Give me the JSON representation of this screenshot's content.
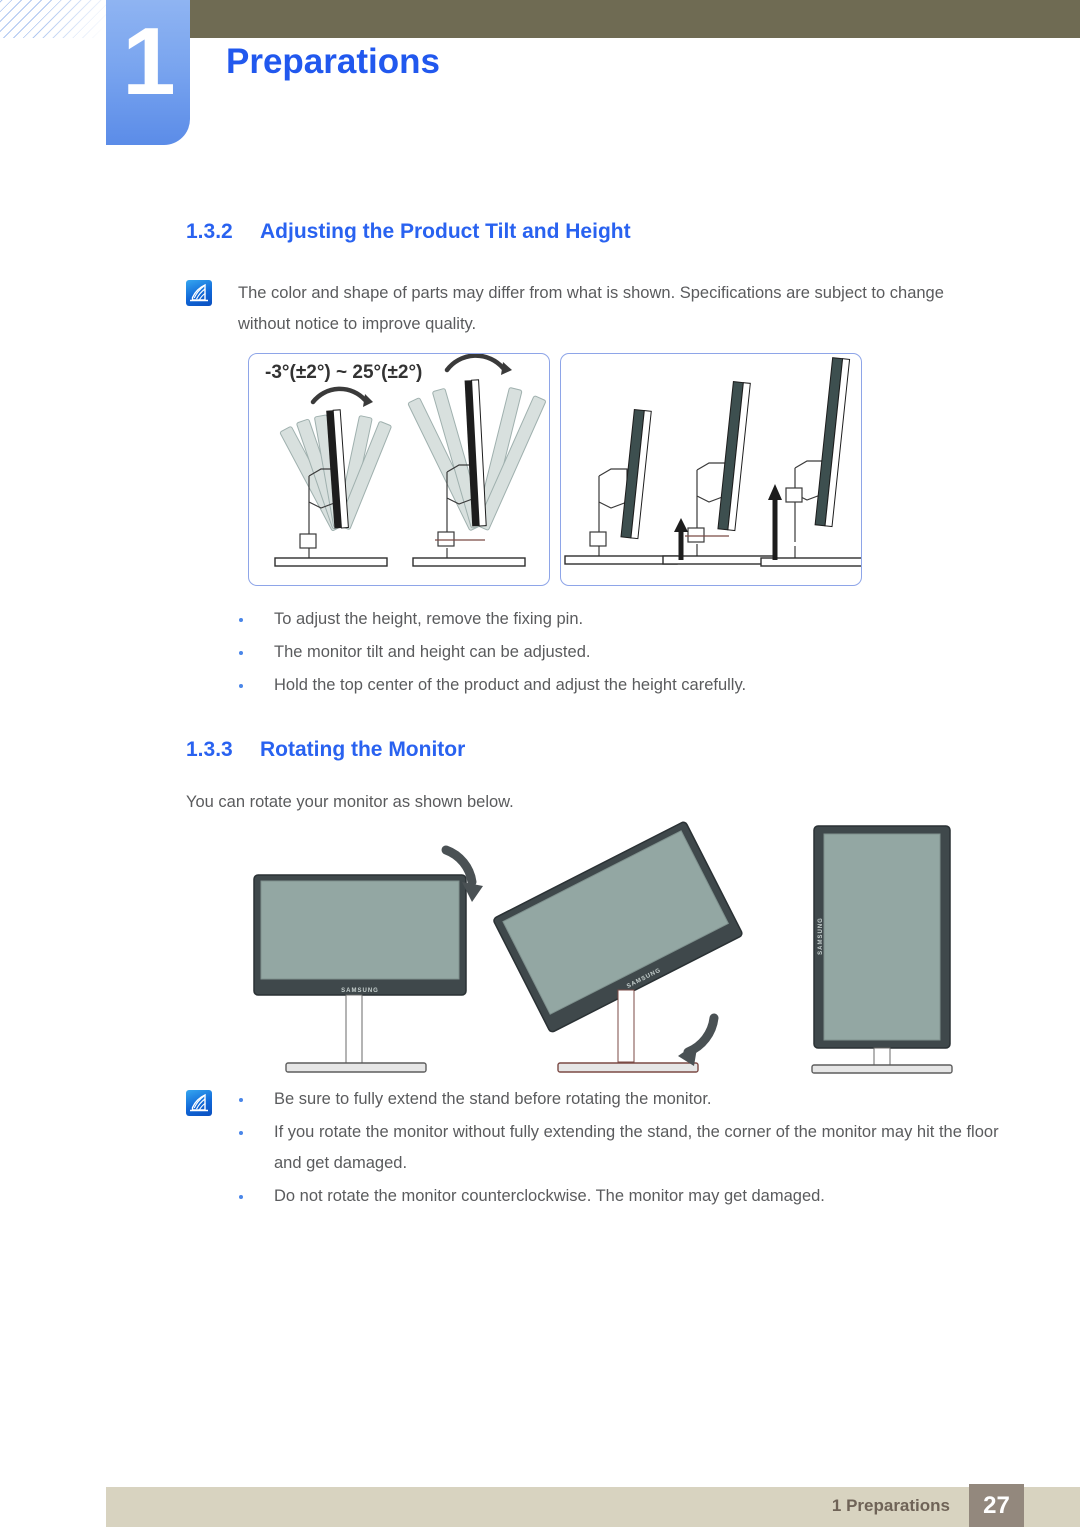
{
  "header": {
    "chapter_number": "1",
    "chapter_title": "Preparations"
  },
  "sections": [
    {
      "number": "1.3.2",
      "title": "Adjusting the Product Tilt and Height",
      "note": "The color and shape of parts may differ from what is shown. Specifications are subject to change without notice to improve quality.",
      "note_icon": "note-pen-icon",
      "tilt_range_label": "-3°(±2°) ~ 25°(±2°)",
      "bullets": [
        "To adjust the height, remove the fixing pin.",
        "The monitor tilt and height can be adjusted.",
        "Hold the top center of the product and adjust the height carefully."
      ]
    },
    {
      "number": "1.3.3",
      "title": "Rotating the Monitor",
      "intro": "You can rotate your monitor as shown below.",
      "note_icon": "note-pen-icon",
      "bullets": [
        "Be sure to fully extend the stand before rotating the monitor.",
        "If you rotate the monitor without fully extending the stand, the corner of the monitor may hit the floor and get damaged.",
        "Do not rotate the monitor counterclockwise. The monitor may get damaged."
      ]
    }
  ],
  "illustrations": {
    "tilt_box_caption": "monitor tilt range side views",
    "height_box_caption": "monitor height adjustment side views",
    "rotate_caption": "monitor rotation landscape to portrait",
    "brand_logo": "SAMSUNG"
  },
  "footer": {
    "label": "1 Preparations",
    "page_number": "27"
  },
  "colors": {
    "accent_blue": "#2962f0",
    "title_blue": "#2158ee",
    "olive": "#6f6b53",
    "footer_bar": "#d8d3c0",
    "footer_page_box": "#93887d",
    "box_border": "#8ea5e8",
    "body_text": "#5a5b5d"
  }
}
